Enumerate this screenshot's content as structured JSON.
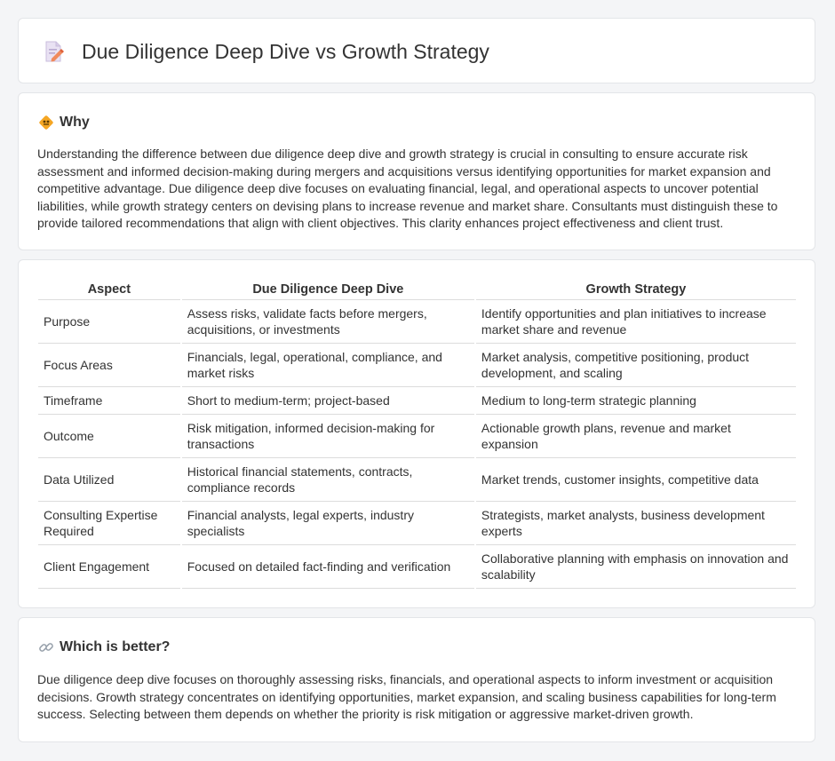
{
  "header": {
    "title": "Due Diligence Deep Dive vs Growth Strategy",
    "icon": "document-pen-icon"
  },
  "why": {
    "title": "Why",
    "icon": "diamond-sign-icon",
    "text": "Understanding the difference between due diligence deep dive and growth strategy is crucial in consulting to ensure accurate risk assessment and informed decision-making during mergers and acquisitions versus identifying opportunities for market expansion and competitive advantage. Due diligence deep dive focuses on evaluating financial, legal, and operational aspects to uncover potential liabilities, while growth strategy centers on devising plans to increase revenue and market share. Consultants must distinguish these to provide tailored recommendations that align with client objectives. This clarity enhances project effectiveness and client trust."
  },
  "table": {
    "headers": [
      "Aspect",
      "Due Diligence Deep Dive",
      "Growth Strategy"
    ],
    "rows": [
      [
        "Purpose",
        "Assess risks, validate facts before mergers, acquisitions, or investments",
        "Identify opportunities and plan initiatives to increase market share and revenue"
      ],
      [
        "Focus Areas",
        "Financials, legal, operational, compliance, and market risks",
        "Market analysis, competitive positioning, product development, and scaling"
      ],
      [
        "Timeframe",
        "Short to medium-term; project-based",
        "Medium to long-term strategic planning"
      ],
      [
        "Outcome",
        "Risk mitigation, informed decision-making for transactions",
        "Actionable growth plans, revenue and market expansion"
      ],
      [
        "Data Utilized",
        "Historical financial statements, contracts, compliance records",
        "Market trends, customer insights, competitive data"
      ],
      [
        "Consulting Expertise Required",
        "Financial analysts, legal experts, industry specialists",
        "Strategists, market analysts, business development experts"
      ],
      [
        "Client Engagement",
        "Focused on detailed fact-finding and verification",
        "Collaborative planning with emphasis on innovation and scalability"
      ]
    ]
  },
  "better": {
    "title": "Which is better?",
    "icon": "link-icon",
    "text": "Due diligence deep dive focuses on thoroughly assessing risks, financials, and operational aspects to inform investment or acquisition decisions. Growth strategy concentrates on identifying opportunities, market expansion, and scaling business capabilities for long-term success. Selecting between them depends on whether the priority is risk mitigation or aggressive market-driven growth."
  }
}
